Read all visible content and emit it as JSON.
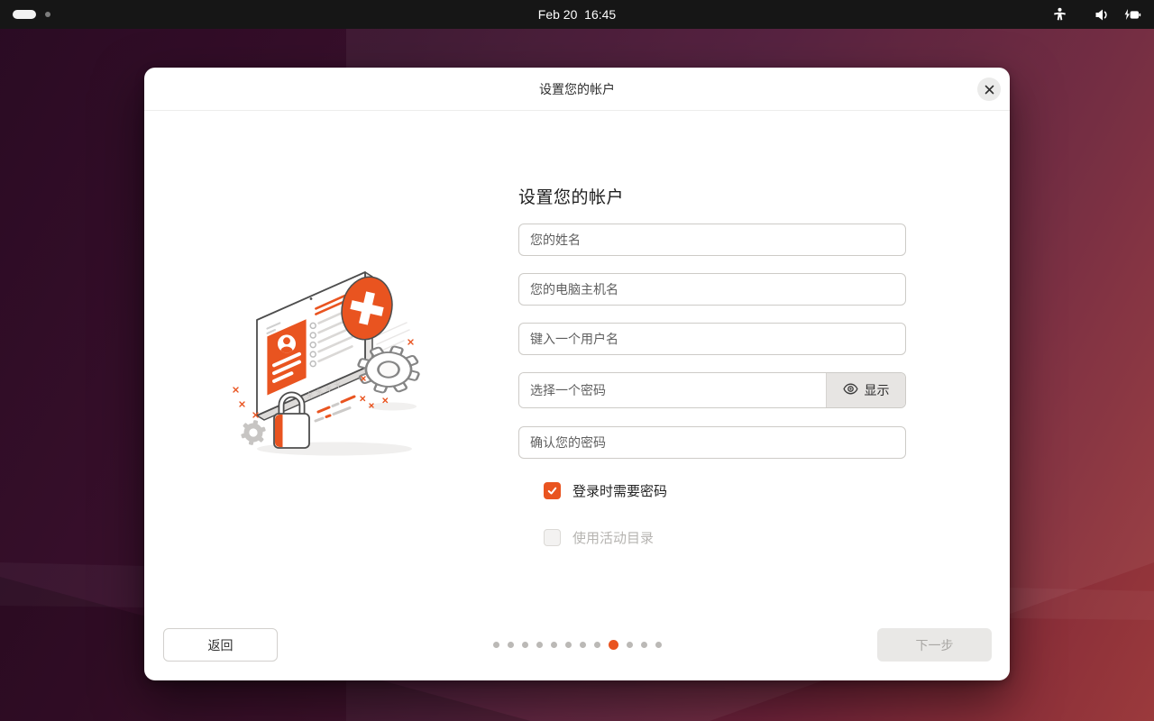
{
  "colors": {
    "accent": "#E95420",
    "topbar-bg": "#161616",
    "wallpaper-dark": "#2a0b23",
    "wallpaper-light": "#9b3a3c",
    "dialog-bg": "#ffffff",
    "disabled-text": "#b6b4b1"
  },
  "topbar": {
    "clock": "Feb 20  16:45",
    "icons": [
      "workspace-indicator",
      "accessibility",
      "volume",
      "battery-charging"
    ]
  },
  "dialog": {
    "title": "设置您的帐户",
    "form": {
      "heading": "设置您的帐户",
      "fields": {
        "fullname": {
          "placeholder": "您的姓名"
        },
        "hostname": {
          "placeholder": "您的电脑主机名"
        },
        "username": {
          "placeholder": "键入一个用户名"
        },
        "password": {
          "placeholder": "选择一个密码",
          "show_label": "显示"
        },
        "confirm": {
          "placeholder": "确认您的密码"
        }
      },
      "checkboxes": [
        {
          "label": "登录时需要密码",
          "checked": true,
          "disabled": false
        },
        {
          "label": "使用活动目录",
          "checked": false,
          "disabled": true
        }
      ]
    },
    "footer": {
      "back_label": "返回",
      "next_label": "下一步",
      "next_enabled": false,
      "page_indicator": {
        "count": 12,
        "active_index": 8
      }
    }
  }
}
